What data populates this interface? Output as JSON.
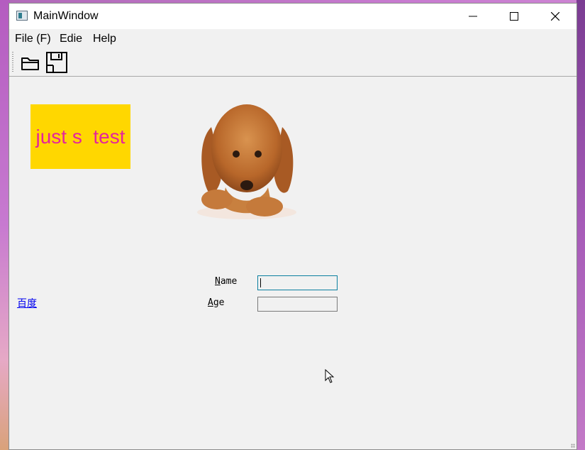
{
  "window": {
    "title": "MainWindow"
  },
  "menubar": {
    "items": [
      "File (F)",
      "Edie",
      "Help"
    ]
  },
  "toolbar": {
    "open_icon": "folder-open-icon",
    "save_icon": "floppy-disk-icon"
  },
  "content": {
    "label_text": "just s  test",
    "label_bg": "#ffd700",
    "label_color": "#e5259c",
    "image": "dog-image",
    "link_text": "百度",
    "form": {
      "name_label_u": "N",
      "name_label_rest": "ame",
      "age_label_u": "A",
      "age_label_rest": "ge",
      "name_value": "",
      "age_value": ""
    }
  }
}
